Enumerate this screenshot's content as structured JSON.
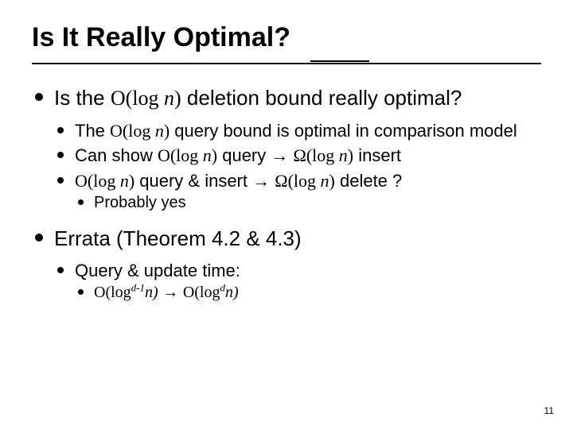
{
  "title": "Is It Really Optimal?",
  "b1": {
    "pre": "Is the ",
    "math": "O(log n)",
    "post": " deletion bound really optimal?",
    "sub": {
      "a": {
        "pre": "The ",
        "math": "O(log n)",
        "post": " query bound is optimal in comparison model"
      },
      "b": {
        "pre": "Can show ",
        "m1": "O(log n)",
        "mid": " query → ",
        "m2": "Ω(log n)",
        "post": " insert"
      },
      "c": {
        "m1": "O(log n)",
        "mid": " query & insert → ",
        "m2": "Ω(log n)",
        "post": " delete ?",
        "sub": "Probably yes"
      }
    }
  },
  "b2": {
    "text": "Errata (Theorem 4.2 & 4.3)",
    "sub": {
      "a": {
        "text": "Query & update time:",
        "sub": {
          "l1": "O(log",
          "e1": "d-1",
          "l2": "n)",
          "arrow": " → ",
          "r1": "O(log",
          "e2": "d",
          "r2": "n)"
        }
      }
    }
  },
  "pagenum": "11"
}
